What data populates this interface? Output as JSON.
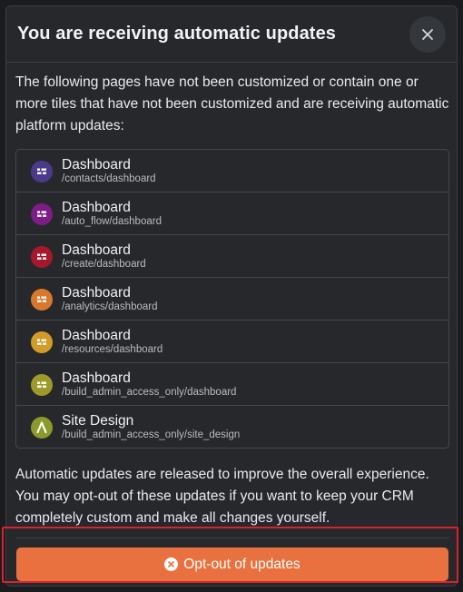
{
  "modal": {
    "title": "You are receiving automatic updates",
    "close_icon": "close-icon",
    "intro": "The following pages have not been customized or contain one or more tiles that have not been customized and are receiving automatic platform updates:",
    "footer": "Automatic updates are released to improve the overall experience. You may opt-out of these updates if you want to keep your CRM completely custom and make all changes yourself.",
    "opt_out_label": "Opt-out of updates",
    "opt_out_icon": "x-circle-icon",
    "accent_color": "#e9713f",
    "focus_color": "#d9232f"
  },
  "pages": [
    {
      "name": "Dashboard",
      "path": "/contacts/dashboard",
      "icon": "dashboard-icon",
      "color": "#4b3a8c"
    },
    {
      "name": "Dashboard",
      "path": "/auto_flow/dashboard",
      "icon": "dashboard-icon",
      "color": "#7e1d87"
    },
    {
      "name": "Dashboard",
      "path": "/create/dashboard",
      "icon": "dashboard-icon",
      "color": "#a8182c"
    },
    {
      "name": "Dashboard",
      "path": "/analytics/dashboard",
      "icon": "dashboard-icon",
      "color": "#d8782d"
    },
    {
      "name": "Dashboard",
      "path": "/resources/dashboard",
      "icon": "dashboard-icon",
      "color": "#d49b28"
    },
    {
      "name": "Dashboard",
      "path": "/build_admin_access_only/dashboard",
      "icon": "dashboard-icon",
      "color": "#9e9a2a"
    },
    {
      "name": "Site Design",
      "path": "/build_admin_access_only/site_design",
      "icon": "site-design-icon",
      "color": "#8c9a2a"
    }
  ]
}
